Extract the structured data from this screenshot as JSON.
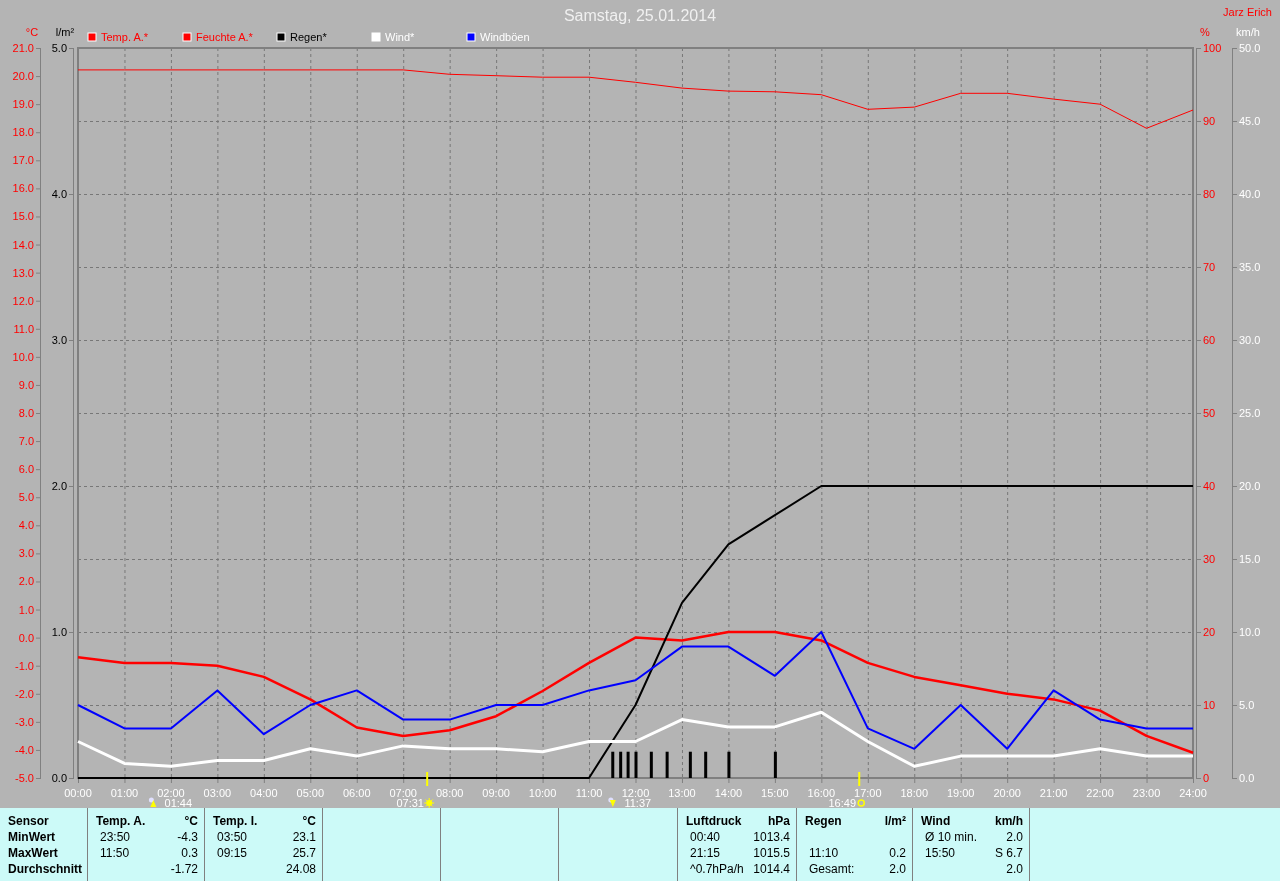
{
  "title": "Samstag, 25.01.2014",
  "author": "Jarz Erich",
  "charts": [
    {
      "chart_data": {
        "type": "line",
        "ylabel": "°C",
        "xlim": [
          0,
          24
        ],
        "ylim": [
          -5,
          21
        ],
        "x": [
          0,
          1,
          2,
          3,
          4,
          5,
          6,
          7,
          8,
          9,
          10,
          11,
          12,
          13,
          14,
          15,
          16,
          17,
          18,
          19,
          20,
          21,
          22,
          23,
          24
        ],
        "xticks": [
          {
            "value": 0,
            "label": "00:00"
          },
          {
            "value": 1,
            "label": "01:00"
          },
          {
            "value": 2,
            "label": "02:00"
          },
          {
            "value": 3,
            "label": "03:00"
          },
          {
            "value": 4,
            "label": "04:00"
          },
          {
            "value": 5,
            "label": "05:00"
          },
          {
            "value": 6,
            "label": "06:00"
          },
          {
            "value": 7,
            "label": "07:00"
          },
          {
            "value": 8,
            "label": "08:00"
          },
          {
            "value": 9,
            "label": "09:00"
          },
          {
            "value": 10,
            "label": "10:00"
          },
          {
            "value": 11,
            "label": "11:00"
          },
          {
            "value": 12,
            "label": "12:00"
          },
          {
            "value": 13,
            "label": "13:00"
          },
          {
            "value": 14,
            "label": "14:00"
          },
          {
            "value": 15,
            "label": "15:00"
          },
          {
            "value": 16,
            "label": "16:00"
          },
          {
            "value": 17,
            "label": "17:00"
          },
          {
            "value": 18,
            "label": "18:00"
          },
          {
            "value": 19,
            "label": "19:00"
          },
          {
            "value": 20,
            "label": "20:00"
          },
          {
            "value": 21,
            "label": "21:00"
          },
          {
            "value": 22,
            "label": "22:00"
          },
          {
            "value": 23,
            "label": "23:00"
          },
          {
            "value": 24,
            "label": "24:00"
          }
        ],
        "yticks": [
          {
            "value": 21,
            "label": "21.0"
          },
          {
            "value": 20,
            "label": "20.0"
          },
          {
            "value": 19,
            "label": "19.0"
          },
          {
            "value": 18,
            "label": "18.0"
          },
          {
            "value": 17,
            "label": "17.0"
          },
          {
            "value": 16,
            "label": "16.0"
          },
          {
            "value": 15,
            "label": "15.0"
          },
          {
            "value": 14,
            "label": "14.0"
          },
          {
            "value": 13,
            "label": "13.0"
          },
          {
            "value": 12,
            "label": "12.0"
          },
          {
            "value": 11,
            "label": "11.0"
          },
          {
            "value": 10,
            "label": "10.0"
          },
          {
            "value": 9,
            "label": "9.0"
          },
          {
            "value": 8,
            "label": "8.0"
          },
          {
            "value": 7,
            "label": "7.0"
          },
          {
            "value": 6,
            "label": "6.0"
          },
          {
            "value": 5,
            "label": "5.0"
          },
          {
            "value": 4,
            "label": "4.0"
          },
          {
            "value": 3,
            "label": "3.0"
          },
          {
            "value": 2,
            "label": "2.0"
          },
          {
            "value": 1,
            "label": "1.0"
          },
          {
            "value": 0,
            "label": "0.0"
          },
          {
            "value": -1,
            "label": "-1.0"
          },
          {
            "value": -2,
            "label": "-2.0"
          },
          {
            "value": -3,
            "label": "-3.0"
          },
          {
            "value": -4,
            "label": "-4.0"
          },
          {
            "value": -5,
            "label": "-5.0"
          }
        ],
        "series": [
          {
            "name": "Temp. A.*",
            "color": "#ff0000",
            "values": [
              -0.7,
              -0.9,
              -0.9,
              -1.0,
              -1.4,
              -2.2,
              -3.2,
              -3.5,
              -3.3,
              -2.8,
              -1.9,
              -0.9,
              0.0,
              -0.1,
              0.2,
              0.2,
              -0.1,
              -0.9,
              -1.4,
              -1.7,
              -2.0,
              -2.2,
              -2.6,
              -3.5,
              -4.1
            ]
          }
        ],
        "annotations": [
          "01:44",
          "07:31",
          "11:37",
          "16:49"
        ]
      }
    },
    {
      "chart_data": {
        "type": "line",
        "ylabel": "%",
        "xlim": [
          0,
          24
        ],
        "ylim": [
          0,
          100
        ],
        "x": [
          0,
          1,
          2,
          3,
          4,
          5,
          6,
          7,
          8,
          9,
          10,
          11,
          12,
          13,
          14,
          15,
          16,
          17,
          18,
          19,
          20,
          21,
          22,
          23,
          24
        ],
        "yticks": [
          {
            "value": 100,
            "label": "100"
          },
          {
            "value": 90,
            "label": "90"
          },
          {
            "value": 80,
            "label": "80"
          },
          {
            "value": 70,
            "label": "70"
          },
          {
            "value": 60,
            "label": "60"
          },
          {
            "value": 50,
            "label": "50"
          },
          {
            "value": 40,
            "label": "40"
          },
          {
            "value": 30,
            "label": "30"
          },
          {
            "value": 20,
            "label": "20"
          },
          {
            "value": 10,
            "label": "10"
          },
          {
            "value": 0,
            "label": "0"
          }
        ],
        "series": [
          {
            "name": "Feuchte A.*",
            "color": "#ff0000",
            "values": [
              97,
              97,
              97,
              97,
              97,
              97,
              97,
              97,
              96.4,
              96.2,
              96,
              96,
              95.3,
              94.5,
              94.1,
              94,
              93.6,
              91.6,
              91.9,
              93.8,
              93.8,
              93,
              92.3,
              89,
              91.5
            ]
          }
        ]
      }
    },
    {
      "chart_data": {
        "type": "line",
        "ylabel": "l/m²",
        "xlim": [
          0,
          24
        ],
        "ylim": [
          0,
          5
        ],
        "x": [
          0,
          1,
          2,
          3,
          4,
          5,
          6,
          7,
          8,
          9,
          10,
          11,
          12,
          13,
          14,
          15,
          16,
          17,
          18,
          19,
          20,
          21,
          22,
          23,
          24
        ],
        "yticks": [
          {
            "value": 5,
            "label": "5.0"
          },
          {
            "value": 4,
            "label": "4.0"
          },
          {
            "value": 3,
            "label": "3.0"
          },
          {
            "value": 2,
            "label": "2.0"
          },
          {
            "value": 1,
            "label": "1.0"
          },
          {
            "value": 0,
            "label": "0.0"
          }
        ],
        "series": [
          {
            "name": "Regen*",
            "color": "#000000",
            "values": [
              0,
              0,
              0,
              0,
              0,
              0,
              0,
              0,
              0,
              0,
              0,
              0,
              0.5,
              1.2,
              1.6,
              1.8,
              2.0,
              2.0,
              2.0,
              2.0,
              2.0,
              2.0,
              2.0,
              2.0,
              2.0
            ]
          }
        ]
      }
    },
    {
      "chart_data": {
        "type": "line",
        "ylabel": "km/h",
        "xlim": [
          0,
          24
        ],
        "ylim": [
          0,
          50
        ],
        "x": [
          0,
          1,
          2,
          3,
          4,
          5,
          6,
          7,
          8,
          9,
          10,
          11,
          12,
          13,
          14,
          15,
          16,
          17,
          18,
          19,
          20,
          21,
          22,
          23,
          24
        ],
        "yticks": [
          {
            "value": 50,
            "label": "50.0"
          },
          {
            "value": 45,
            "label": "45.0"
          },
          {
            "value": 40,
            "label": "40.0"
          },
          {
            "value": 35,
            "label": "35.0"
          },
          {
            "value": 30,
            "label": "30.0"
          },
          {
            "value": 25,
            "label": "25.0"
          },
          {
            "value": 20,
            "label": "20.0"
          },
          {
            "value": 15,
            "label": "15.0"
          },
          {
            "value": 10,
            "label": "10.0"
          },
          {
            "value": 5,
            "label": "5.0"
          },
          {
            "value": 0,
            "label": "0.0"
          }
        ],
        "series": [
          {
            "name": "Wind*",
            "color": "#ffffff",
            "values": [
              2.5,
              1.0,
              0.8,
              1.2,
              1.2,
              2.0,
              1.5,
              2.2,
              2.0,
              2.0,
              1.8,
              2.5,
              2.5,
              4.0,
              3.5,
              3.5,
              4.5,
              2.5,
              0.8,
              1.5,
              1.5,
              1.5,
              2.0,
              1.5,
              1.5
            ]
          },
          {
            "name": "Windböen",
            "color": "#0000ff",
            "values": [
              5.0,
              3.4,
              3.4,
              6.0,
              3.0,
              5.0,
              6.0,
              4.0,
              4.0,
              5.0,
              5.0,
              6.0,
              6.7,
              9.0,
              9.0,
              7.0,
              10.0,
              3.4,
              2.0,
              5.0,
              2.0,
              6.0,
              4.0,
              3.4,
              3.4
            ]
          }
        ]
      }
    },
    {
      "chart_data": {
        "type": "bar",
        "xlim": [
          0,
          24
        ],
        "ylim": [
          0,
          5
        ],
        "x": [
          11.5,
          11.67,
          11.83,
          12.0,
          12.33,
          12.67,
          13.17,
          13.5,
          14.0,
          15.0
        ],
        "series": [
          {
            "color": "#000000",
            "values": [
              0.18,
              0.18,
              0.18,
              0.18,
              0.18,
              0.18,
              0.18,
              0.18,
              0.18,
              0.18
            ]
          }
        ]
      }
    }
  ],
  "events": [
    {
      "kind": "moonrise"
    },
    {
      "kind": "sunrise"
    },
    {
      "kind": "moonset"
    },
    {
      "kind": "sunset"
    }
  ],
  "stats": {
    "row_labels": [
      "Sensor",
      "MinWert",
      "MaxWert",
      "Durchschnitt"
    ],
    "columns": [
      {
        "kind": "sensor",
        "name": "Temp. A.",
        "unit": "°C",
        "rows": [
          {
            "time": "23:50",
            "value": "-4.3"
          },
          {
            "time": "11:50",
            "value": "0.3"
          },
          {
            "value": "-1.72"
          }
        ]
      },
      {
        "kind": "sensor",
        "name": "Temp. I.",
        "unit": "°C",
        "rows": [
          {
            "time": "03:50",
            "value": "23.1"
          },
          {
            "time": "09:15",
            "value": "25.7"
          },
          {
            "value": "24.08"
          }
        ]
      },
      {
        "kind": "empty"
      },
      {
        "kind": "empty"
      },
      {
        "kind": "empty"
      },
      {
        "kind": "sensor",
        "name": "Luftdruck",
        "unit": "hPa",
        "rows": [
          {
            "time": "00:40",
            "value": "1013.4"
          },
          {
            "time": "21:15",
            "value": "1015.5"
          },
          {
            "time": "^0.7hPa/h",
            "value": "1014.4"
          }
        ]
      },
      {
        "kind": "sensor",
        "name": "Regen",
        "unit": "l/m²",
        "rows": [
          {},
          {
            "time": "11:10",
            "value": "0.2"
          },
          {
            "time": "Gesamt:",
            "value": "2.0"
          }
        ]
      },
      {
        "kind": "sensor",
        "name": "Wind",
        "unit": "km/h",
        "rows": [
          {
            "time": "Ø 10 min.",
            "value": "2.0"
          },
          {
            "time": "15:50",
            "value": "S 6.7"
          },
          {
            "value": "2.0"
          }
        ]
      },
      {
        "kind": "empty"
      }
    ]
  }
}
